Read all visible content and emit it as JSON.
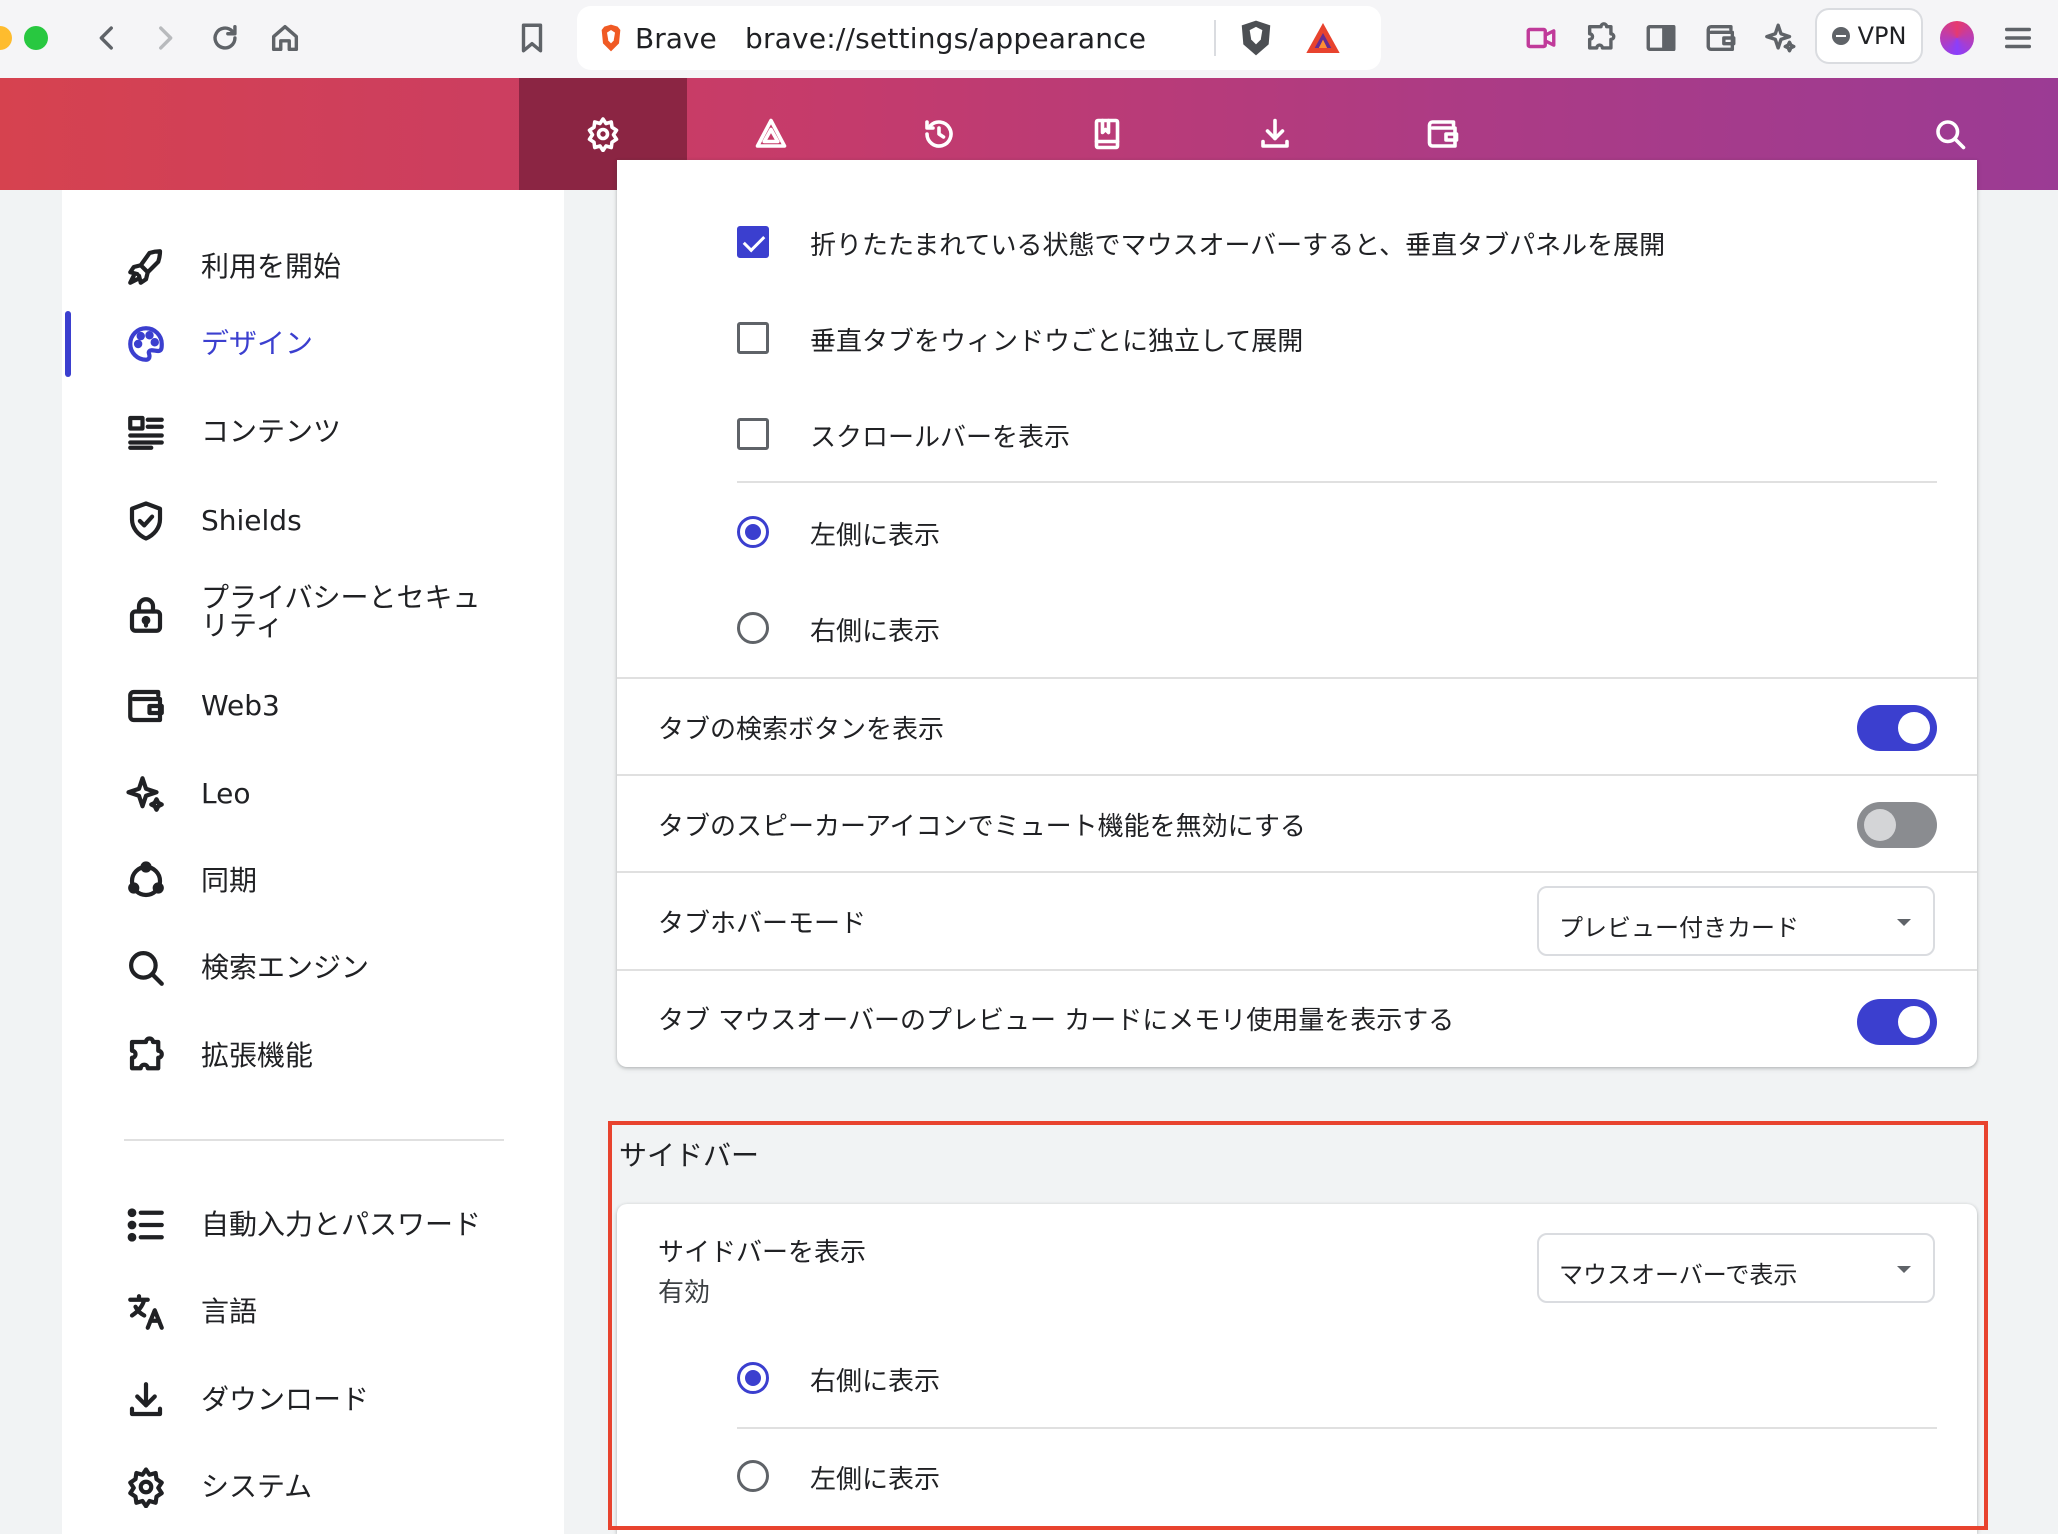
{
  "browser": {
    "tab_name": "Brave",
    "url": "brave://settings/appearance",
    "vpn_label": "VPN"
  },
  "sidebar": {
    "items": [
      {
        "label": "利用を開始",
        "icon": "rocket-icon"
      },
      {
        "label": "デザイン",
        "icon": "palette-icon",
        "active": true
      },
      {
        "label": "コンテンツ",
        "icon": "content-icon"
      },
      {
        "label": "Shields",
        "icon": "shield-icon"
      },
      {
        "label": "プライバシーとセキュリティ",
        "label_line1": "プライバシーとセキュ",
        "label_line2": "リティ",
        "icon": "lock-icon"
      },
      {
        "label": "Web3",
        "icon": "wallet-icon"
      },
      {
        "label": "Leo",
        "icon": "sparkle-icon"
      },
      {
        "label": "同期",
        "icon": "sync-icon"
      },
      {
        "label": "検索エンジン",
        "icon": "search-icon"
      },
      {
        "label": "拡張機能",
        "icon": "puzzle-icon"
      },
      {
        "label": "自動入力とパスワード",
        "icon": "list-icon"
      },
      {
        "label": "言語",
        "icon": "translate-icon"
      },
      {
        "label": "ダウンロード",
        "icon": "download-icon"
      },
      {
        "label": "システム",
        "icon": "gear-icon"
      }
    ]
  },
  "tabs_card": {
    "expand_on_hover": {
      "label": "折りたたまれている状態でマウスオーバーすると、垂直タブパネルを展開",
      "checked": true
    },
    "expand_per_window": {
      "label": "垂直タブをウィンドウごとに独立して展開",
      "checked": false
    },
    "show_scrollbar": {
      "label": "スクロールバーを表示",
      "checked": false
    },
    "position_left": {
      "label": "左側に表示",
      "selected": true
    },
    "position_right": {
      "label": "右側に表示",
      "selected": false
    },
    "show_search_button": {
      "label": "タブの検索ボタンを表示",
      "on": true
    },
    "disable_mute": {
      "label": "タブのスピーカーアイコンでミュート機能を無効にする",
      "on": false
    },
    "hover_mode": {
      "label": "タブホバーモード",
      "value": "プレビュー付きカード"
    },
    "memory_usage": {
      "label": "タブ マウスオーバーのプレビュー カードにメモリ使用量を表示する",
      "on": true
    }
  },
  "sidebar_section": {
    "title": "サイドバー",
    "show_sidebar_label": "サイドバーを表示",
    "show_sidebar_sub": "有効",
    "show_sidebar_value": "マウスオーバーで表示",
    "position_right": {
      "label": "右側に表示",
      "selected": true
    },
    "position_left": {
      "label": "左側に表示",
      "selected": false
    }
  },
  "colors": {
    "accent": "#3b3fcf",
    "header_gradient_start": "#d6424f",
    "header_gradient_end": "#9b3b94",
    "highlight_border": "#e8432e"
  }
}
